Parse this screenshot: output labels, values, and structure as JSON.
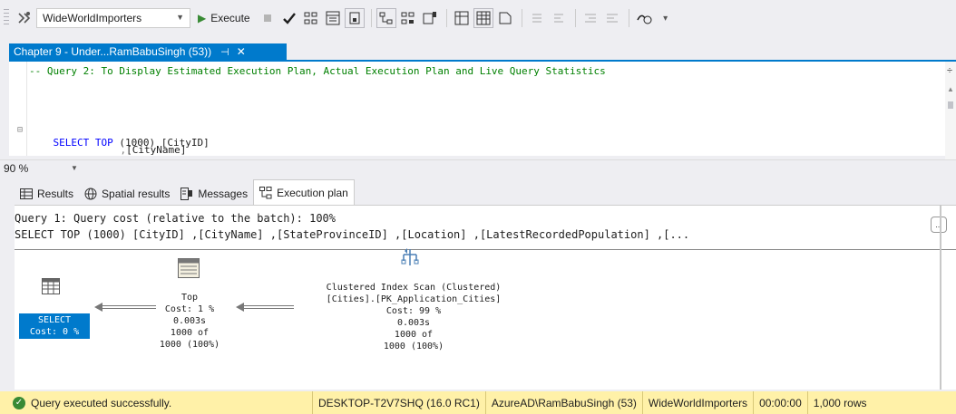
{
  "toolbar": {
    "database": "WideWorldImporters",
    "execute_label": "Execute"
  },
  "document_tab": {
    "title": "Chapter 9 - Under...RamBabuSingh (53))",
    "pin": "⊣",
    "close": "✕"
  },
  "editor": {
    "line1": "-- Query 2: To Display Estimated Execution Plan, Actual Execution Plan and Live Query Statistics",
    "line2_kw": "SELECT TOP",
    "line2_num": "(1000)",
    "line2_col": "[CityID]",
    "line3_comma": ",",
    "line3_col": "[CityName]"
  },
  "zoom": {
    "value": "90 %"
  },
  "result_tabs": [
    {
      "label": "Results",
      "icon": "grid-icon"
    },
    {
      "label": "Spatial results",
      "icon": "globe-icon"
    },
    {
      "label": "Messages",
      "icon": "messages-icon"
    },
    {
      "label": "Execution plan",
      "icon": "plan-icon"
    }
  ],
  "plan": {
    "header_line1": "Query 1: Query cost (relative to the batch): 100%",
    "header_line2": "SELECT TOP (1000) [CityID] ,[CityName] ,[StateProvinceID] ,[Location] ,[LatestRecordedPopulation] ,[...",
    "more_label": "...",
    "select_node": {
      "name": "SELECT",
      "cost": "Cost: 0 %"
    },
    "top_node": {
      "name": "Top",
      "cost": "Cost: 1 %",
      "time": "0.003s",
      "rows1": "1000 of",
      "rows2": "1000 (100%)"
    },
    "scan_node": {
      "name": "Clustered Index Scan (Clustered)",
      "object": "[Cities].[PK_Application_Cities]",
      "cost": "Cost: 99 %",
      "time": "0.003s",
      "rows1": "1000 of",
      "rows2": "1000 (100%)"
    }
  },
  "status": {
    "message": "Query executed successfully.",
    "server": "DESKTOP-T2V7SHQ (16.0 RC1)",
    "user": "AzureAD\\RamBabuSingh (53)",
    "database": "WideWorldImporters",
    "elapsed": "00:00:00",
    "rows": "1,000 rows"
  },
  "colors": {
    "accent": "#007acc",
    "status_bar": "#fff1a8",
    "comment": "#008000",
    "keyword": "#0000ff"
  }
}
